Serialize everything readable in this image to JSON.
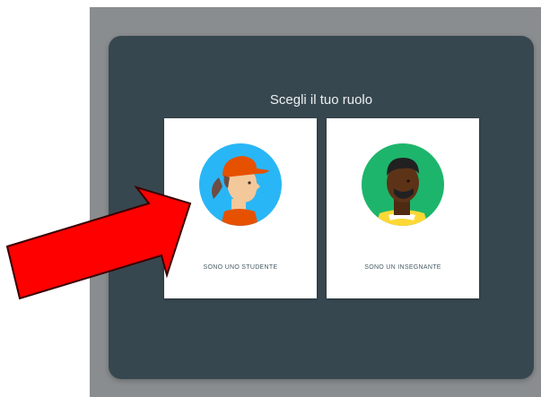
{
  "dialog": {
    "title": "Scegli il tuo ruolo",
    "roles": [
      {
        "label": "SONO UNO STUDENTE",
        "icon": "student-avatar-icon",
        "circle_color": "#29b6f6"
      },
      {
        "label": "SONO UN INSEGNANTE",
        "icon": "teacher-avatar-icon",
        "circle_color": "#1db56b"
      }
    ]
  },
  "annotation": {
    "icon": "red-arrow-icon",
    "color": "#ff0000",
    "points_to": "SONO UNO STUDENTE"
  },
  "colors": {
    "dialog_bg": "#37474f",
    "backdrop": "#8a8d8f",
    "card_bg": "#ffffff"
  }
}
